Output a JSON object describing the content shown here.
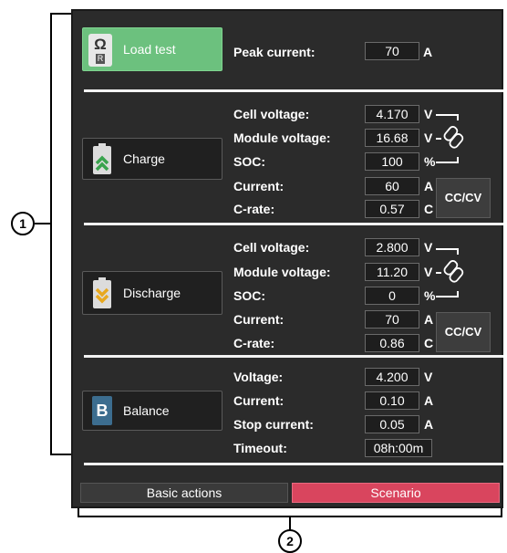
{
  "sections": {
    "load_test": {
      "button_label": "Load test",
      "icon_symbol": "Ω",
      "icon_sub": "R",
      "peak_label": "Peak current:",
      "peak_value": "70",
      "peak_unit": "A"
    },
    "charge": {
      "button_label": "Charge",
      "icon": "battery-charge-icon",
      "rows": {
        "cell_voltage": {
          "label": "Cell voltage:",
          "value": "4.170",
          "unit": "V"
        },
        "module_voltage": {
          "label": "Module voltage:",
          "value": "16.68",
          "unit": "V"
        },
        "soc": {
          "label": "SOC:",
          "value": "100",
          "unit": "%"
        },
        "current": {
          "label": "Current:",
          "value": "60",
          "unit": "A"
        },
        "c_rate": {
          "label": "C-rate:",
          "value": "0.57",
          "unit": "C"
        }
      },
      "mode_button": "CC/CV"
    },
    "discharge": {
      "button_label": "Discharge",
      "icon": "battery-discharge-icon",
      "rows": {
        "cell_voltage": {
          "label": "Cell voltage:",
          "value": "2.800",
          "unit": "V"
        },
        "module_voltage": {
          "label": "Module voltage:",
          "value": "11.20",
          "unit": "V"
        },
        "soc": {
          "label": "SOC:",
          "value": "0",
          "unit": "%"
        },
        "current": {
          "label": "Current:",
          "value": "70",
          "unit": "A"
        },
        "c_rate": {
          "label": "C-rate:",
          "value": "0.86",
          "unit": "C"
        }
      },
      "mode_button": "CC/CV"
    },
    "balance": {
      "button_label": "Balance",
      "icon_letter": "B",
      "rows": {
        "voltage": {
          "label": "Voltage:",
          "value": "4.200",
          "unit": "V"
        },
        "current": {
          "label": "Current:",
          "value": "0.10",
          "unit": "A"
        },
        "stop_current": {
          "label": "Stop current:",
          "value": "0.05",
          "unit": "A"
        },
        "timeout": {
          "label": "Timeout:",
          "value": "08h:00m"
        }
      }
    }
  },
  "tabs": {
    "basic_actions": "Basic actions",
    "scenario": "Scenario"
  },
  "callouts": {
    "one": "1",
    "two": "2"
  },
  "colors": {
    "panel_bg": "#2b2b2b",
    "load_test_green": "#6cc17e",
    "scenario_red": "#d9455e",
    "battery_green": "#5bbf6a",
    "battery_yellow": "#e7b52a"
  }
}
